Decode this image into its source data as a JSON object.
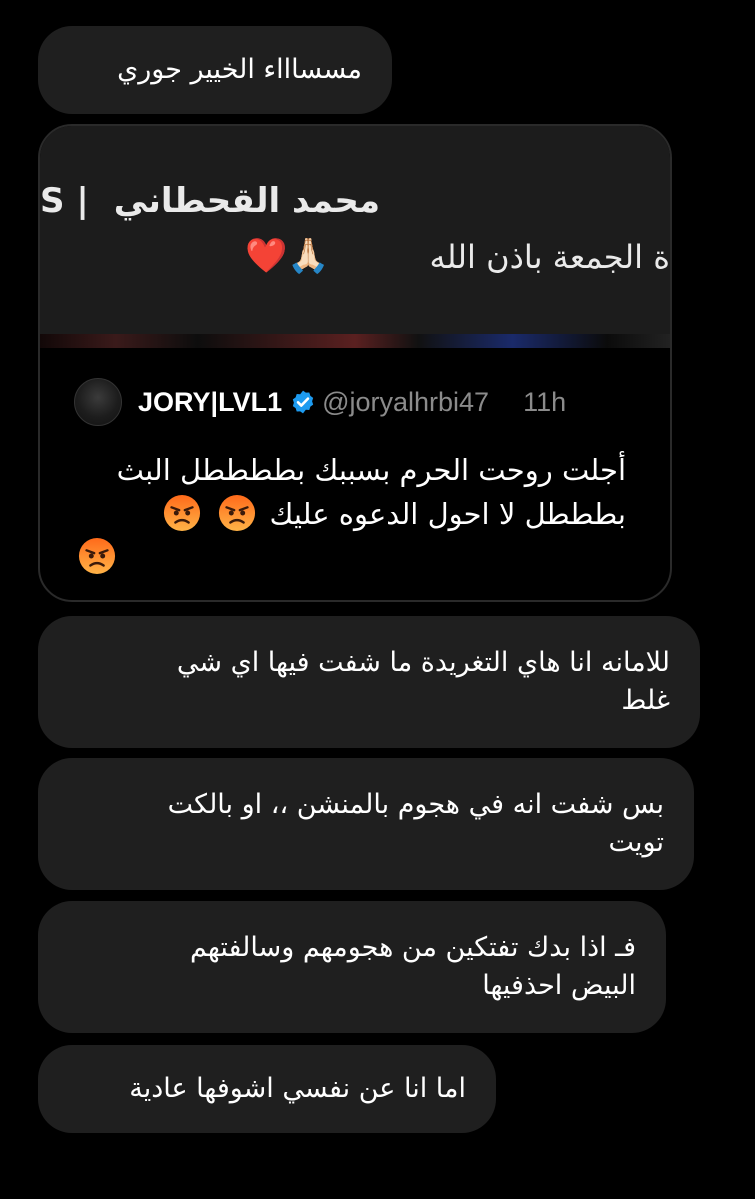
{
  "messages": {
    "m1": "مسساااء الخيير جوري",
    "m2": "للامانه انا هاي التغريدة ما شفت فيها اي شي\nغلط",
    "m3": "بس شفت انه في هجوم بالمنشن ،، او بالكت\nتويت",
    "m4": "فـ اذا بدك تفتكين من هجومهم وسالفتهم\nالبيض احذفيها",
    "m5": "اما انا عن نفسي اشوفها عادية"
  },
  "card": {
    "media_line1": "محمد القحطاني",
    "media_line1_tail": "S |",
    "media_line2": "ة الجمعة باذن الله",
    "media_emoji": "❤️🙏🏻",
    "author_name": "JORY|LVL1",
    "author_handle": "@joryalhrbi47",
    "time": "11h",
    "tweet_text": "أجلت روحت الحرم بسببك بططططل البث بطططل لا احول الدعوه عليك",
    "icons": {
      "verified": "verified-badge-icon",
      "angry": "angry-face-emoji"
    },
    "colors": {
      "verified": "#1d9bf0",
      "angry_top": "#ff7a1a",
      "angry_bottom": "#ffb347"
    }
  }
}
